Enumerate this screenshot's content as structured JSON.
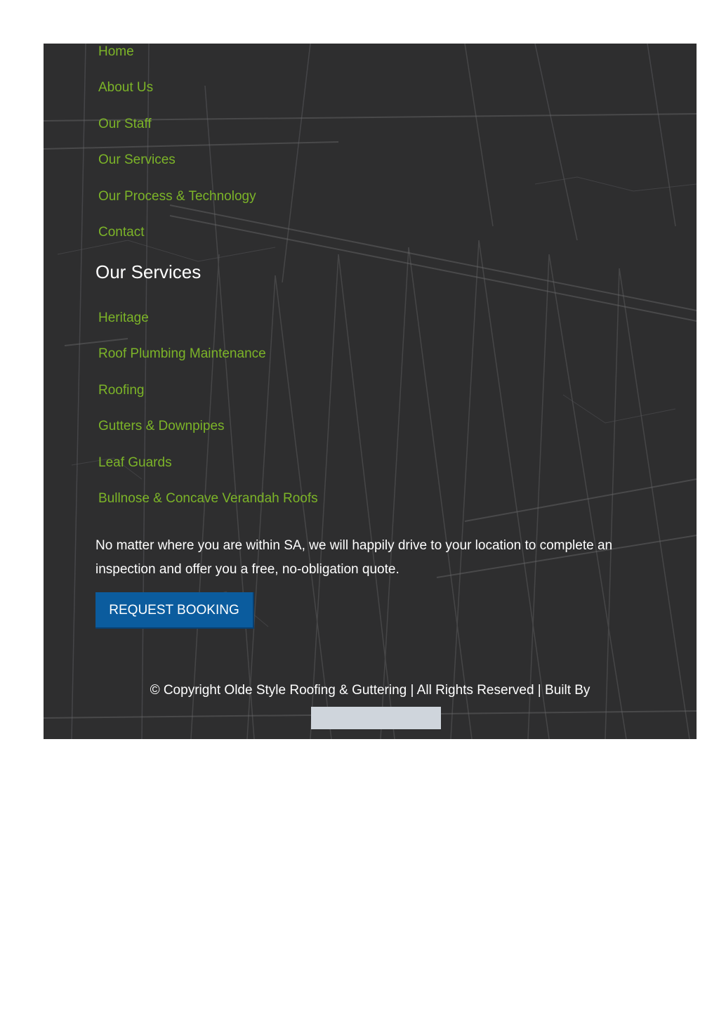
{
  "main_nav": [
    {
      "label": "Home"
    },
    {
      "label": "About Us"
    },
    {
      "label": "Our Staff"
    },
    {
      "label": "Our Services"
    },
    {
      "label": "Our Process & Technology"
    },
    {
      "label": "Contact"
    }
  ],
  "services_section": {
    "heading": "Our Services",
    "items": [
      {
        "label": "Heritage"
      },
      {
        "label": "Roof Plumbing Maintenance"
      },
      {
        "label": "Roofing"
      },
      {
        "label": "Gutters & Downpipes"
      },
      {
        "label": "Leaf Guards"
      },
      {
        "label": "Bullnose & Concave Verandah Roofs"
      }
    ]
  },
  "intro": {
    "text": "No matter where you are within SA, we will happily drive to your location to complete an inspection and offer you a free, no-obligation quote."
  },
  "booking_button": {
    "label": "REQUEST BOOKING"
  },
  "copyright": {
    "text": "© Copyright Olde Style Roofing & Guttering | All Rights Reserved | Built By"
  },
  "colors": {
    "panel_background": "#2e2e2f",
    "link": "#7cb428",
    "button": "#0b5c9e",
    "text": "#ffffff"
  }
}
